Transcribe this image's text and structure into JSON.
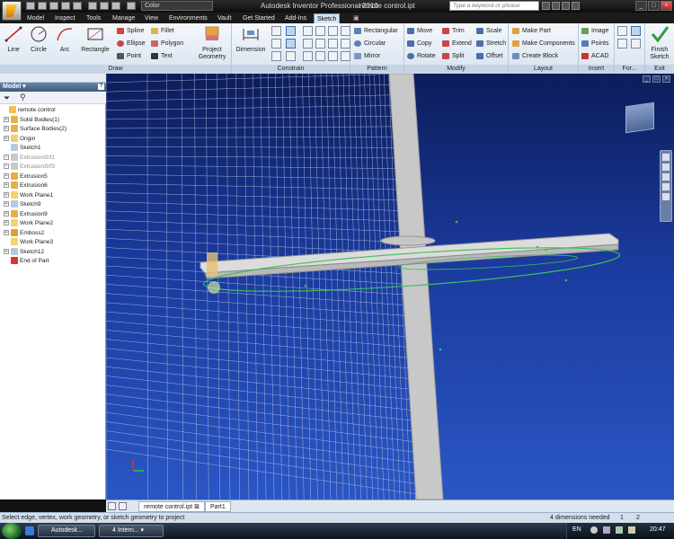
{
  "titlebar": {
    "color_dropdown": "Color",
    "app_title": "Autodesk Inventor Professional 2010",
    "file_title": "remote control.ipt",
    "search_placeholder": "Type a keyword or phrase"
  },
  "tabs": [
    "Model",
    "Inspect",
    "Tools",
    "Manage",
    "View",
    "Environments",
    "Vault",
    "Get Started",
    "Add-Ins",
    "Sketch"
  ],
  "ribbon": {
    "draw": {
      "label": "Draw",
      "line": "Line",
      "circle": "Circle",
      "arc": "Arc",
      "rectangle": "Rectangle",
      "spline": "Spline",
      "ellipse": "Ellipse",
      "point": "Point",
      "fillet": "Fillet",
      "polygon": "Polygon",
      "text": "Text",
      "project_geometry_1": "Project",
      "project_geometry_2": "Geometry"
    },
    "constrain": {
      "label": "Constrain",
      "dimension": "Dimension"
    },
    "pattern": {
      "label": "Pattern",
      "rectangular": "Rectangular",
      "circular": "Circular",
      "mirror": "Mirror"
    },
    "modify": {
      "label": "Modify",
      "move": "Move",
      "copy": "Copy",
      "rotate": "Rotate",
      "trim": "Trim",
      "extend": "Extend",
      "split": "Split",
      "scale": "Scale",
      "stretch": "Stretch",
      "offset": "Offset"
    },
    "layout": {
      "label": "Layout",
      "make_part": "Make Part",
      "make_components": "Make Components",
      "create_block": "Create Block"
    },
    "insert": {
      "label": "Insert",
      "image": "Image",
      "points": "Points",
      "acad": "ACAD"
    },
    "format": {
      "label": "For..."
    },
    "exit": {
      "label": "Exit",
      "finish_1": "Finish",
      "finish_2": "Sketch"
    }
  },
  "browser": {
    "header": "Model",
    "items": [
      {
        "label": "remote control",
        "dim": false,
        "color": "#f3c04a"
      },
      {
        "label": "Solid Bodies(1)",
        "dim": false,
        "color": "#e8b040"
      },
      {
        "label": "Surface Bodies(2)",
        "dim": false,
        "color": "#e8b040"
      },
      {
        "label": "Origin",
        "dim": false,
        "color": "#f0d070"
      },
      {
        "label": "Sketch1",
        "dim": false,
        "color": "#b8c8e0"
      },
      {
        "label": "ExtrusionSrf1",
        "dim": true,
        "color": "#c9c9c9"
      },
      {
        "label": "ExtrusionSrf3",
        "dim": true,
        "color": "#c9c9c9"
      },
      {
        "label": "Extrusion5",
        "dim": false,
        "color": "#e8b040"
      },
      {
        "label": "Extrusion6",
        "dim": false,
        "color": "#e8b040"
      },
      {
        "label": "Work Plane1",
        "dim": false,
        "color": "#f3d36b"
      },
      {
        "label": "Sketch9",
        "dim": false,
        "color": "#b8c8e0"
      },
      {
        "label": "Extrusion9",
        "dim": false,
        "color": "#e8b040"
      },
      {
        "label": "Work Plane2",
        "dim": false,
        "color": "#f3d36b"
      },
      {
        "label": "Emboss2",
        "dim": false,
        "color": "#e0a030"
      },
      {
        "label": "Work Plane3",
        "dim": false,
        "color": "#f3d36b"
      },
      {
        "label": "Sketch12",
        "dim": false,
        "color": "#b8c8e0"
      },
      {
        "label": "End of Part",
        "dim": false,
        "color": "#d33"
      }
    ]
  },
  "doc_tabs": [
    "remote control.ipt",
    "Part1"
  ],
  "status": {
    "message": "Select edge, vertex, work geometry, or sketch geometry to project",
    "dims_needed": "4 dimensions needed",
    "count_a": "1",
    "count_b": "2"
  },
  "taskbar": {
    "btn1": "Autodesk...",
    "btn2": "4 Intern...",
    "lang": "EN",
    "clock": "20:47"
  },
  "colors": {
    "accent": "#1f4ea8",
    "ribbon_bg": "#dde8f3",
    "sketch_green": "#3cbf5a"
  }
}
